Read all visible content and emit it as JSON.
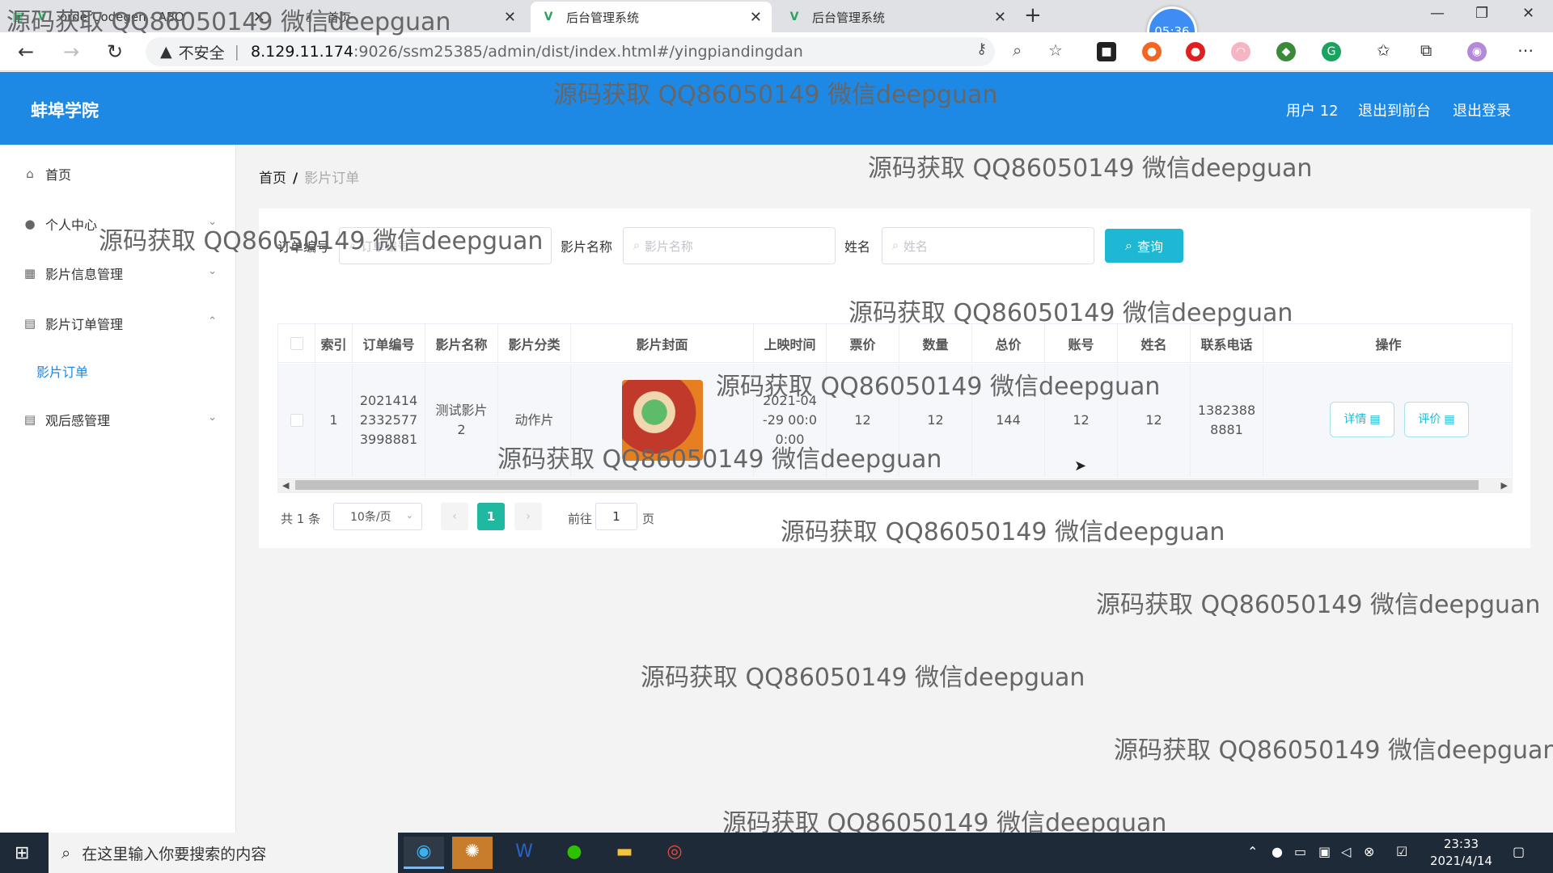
{
  "browser": {
    "tabs": [
      {
        "title": "orderCodegen - ABO",
        "favicon": "vue-icon"
      },
      {
        "title": "首页",
        "favicon": "page-icon"
      },
      {
        "title": "后台管理系统",
        "favicon": "vue-icon",
        "active": true
      },
      {
        "title": "后台管理系统",
        "favicon": "vue-icon"
      }
    ],
    "address": {
      "security_label": "不安全",
      "host": "8.129.11.174",
      "path": ":9026/ssm25385/admin/dist/index.html#/yingpiandingdan"
    },
    "clock_badge": "05:36"
  },
  "header": {
    "brand": "蚌埠学院",
    "user_label": "用户 12",
    "back_front": "退出到前台",
    "logout": "退出登录",
    "color": "#1e88e5"
  },
  "sidebar": {
    "items": [
      {
        "label": "首页",
        "icon": "home-icon"
      },
      {
        "label": "个人中心",
        "icon": "user-icon"
      },
      {
        "label": "影片信息管理",
        "icon": "grid-icon"
      },
      {
        "label": "影片订单管理",
        "icon": "clipboard-icon",
        "expanded": true
      },
      {
        "label": "观后感管理",
        "icon": "clipboard-icon"
      }
    ],
    "submenu": {
      "label": "影片订单"
    }
  },
  "breadcrumb": {
    "home": "首页",
    "current": "影片订单"
  },
  "filters": {
    "order_no": {
      "label": "订单编号",
      "placeholder": "订单编号"
    },
    "movie_name": {
      "label": "影片名称",
      "placeholder": "影片名称"
    },
    "name": {
      "label": "姓名",
      "placeholder": "姓名"
    },
    "query_button": "查询"
  },
  "table": {
    "columns": [
      "索引",
      "订单编号",
      "影片名称",
      "影片分类",
      "影片封面",
      "上映时间",
      "票价",
      "数量",
      "总价",
      "账号",
      "姓名",
      "联系电话",
      "操作"
    ],
    "rows": [
      {
        "index": "1",
        "order_no": "20214142332577 3998881",
        "order_no_lines": [
          "2021414",
          "2332577",
          "3998881"
        ],
        "movie_name_lines": [
          "测试影片",
          "2"
        ],
        "category": "动作片",
        "release_lines": [
          "2021-04",
          "-29 00:0",
          "0:00"
        ],
        "price": "12",
        "quantity": "12",
        "total": "144",
        "account": "12",
        "name": "12",
        "phone_lines": [
          "1382388",
          "8881"
        ],
        "actions": {
          "detail": "详情",
          "review": "评价"
        }
      }
    ]
  },
  "pagination": {
    "total_text": "共 1 条",
    "page_size": "10条/页",
    "current_page": "1",
    "goto_label": "前往",
    "goto_value": "1",
    "page_unit": "页"
  },
  "watermark": "源码获取 QQ86050149 微信deepguan",
  "taskbar": {
    "search_placeholder": "在这里输入你要搜索的内容",
    "time": "23:33",
    "date": "2021/4/14"
  }
}
